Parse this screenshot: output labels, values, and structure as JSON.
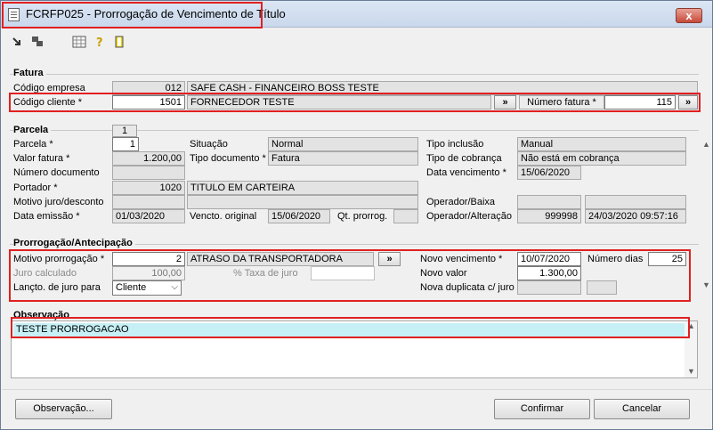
{
  "window": {
    "title": "FCRFP025 - Prorrogação de Vencimento de Título",
    "close": "x"
  },
  "toolbar": {
    "icons": [
      "arrow-icon",
      "copy-icon",
      "calculator-icon",
      "help-icon",
      "exit-door-icon"
    ]
  },
  "fatura": {
    "group_label": "Fatura",
    "empresa_label": "Código empresa",
    "empresa_code": "012",
    "empresa_name": "SAFE CASH - FINANCEIRO BOSS TESTE",
    "cliente_label": "Código cliente *",
    "cliente_code": "1501",
    "cliente_name": "FORNECEDOR TESTE",
    "lookup_btn": "»",
    "numero_label": "Número fatura *",
    "numero_value": "115",
    "numero_btn": "»"
  },
  "parcela": {
    "group_label": "Parcela",
    "tab_label": "1",
    "parcela_label": "Parcela *",
    "parcela_value": "1",
    "valor_label": "Valor fatura *",
    "valor_value": "1.200,00",
    "numero_doc_label": "Número documento",
    "numero_doc_value": "",
    "portador_label": "Portador *",
    "portador_code": "1020",
    "portador_name": "TITULO EM CARTEIRA",
    "motivo_label": "Motivo juro/desconto",
    "motivo_code": "",
    "motivo_name": "",
    "emissao_label": "Data emissão *",
    "emissao_value": "01/03/2020",
    "situacao_label": "Situação",
    "situacao_value": "Normal",
    "tipo_doc_label": "Tipo documento *",
    "tipo_doc_value": "Fatura",
    "vencto_label": "Vencto. original",
    "vencto_value": "15/06/2020",
    "qt_label": "Qt. prorrog.",
    "qt_value": "",
    "tipo_inclusao_label": "Tipo inclusão",
    "tipo_inclusao_value": "Manual",
    "tipo_cobranca_label": "Tipo de cobrança",
    "tipo_cobranca_value": "Não está em cobrança",
    "data_venc_label": "Data vencimento *",
    "data_venc_value": "15/06/2020",
    "op_baixa_label": "Operador/Baixa",
    "op_baixa_code": "",
    "op_baixa_date": "",
    "op_alt_label": "Operador/Alteração",
    "op_alt_code": "999998",
    "op_alt_date": "24/03/2020 09:57:16"
  },
  "prorrogacao": {
    "group_label": "Prorrogação/Antecipação",
    "motivo_label": "Motivo prorrogação *",
    "motivo_code": "2",
    "motivo_name": "ATRASO DA TRANSPORTADORA",
    "motivo_btn": "»",
    "juro_calc_label": "Juro calculado",
    "juro_calc_value": "100,00",
    "taxa_label": "% Taxa de juro",
    "taxa_value": "",
    "lancto_label": "Lançto. de juro para",
    "lancto_value": "Cliente",
    "novo_venc_label": "Novo vencimento *",
    "novo_venc_value": "10/07/2020",
    "numero_dias_label": "Número dias",
    "numero_dias_value": "25",
    "novo_valor_label": "Novo valor",
    "novo_valor_value": "1.300,00",
    "nova_dup_label": "Nova duplicata c/ juro",
    "nova_dup_value": "",
    "nova_dup_extra": ""
  },
  "observacao": {
    "group_label": "Observação",
    "text": "TESTE PRORROGACAO"
  },
  "buttons": {
    "observacao": "Observação...",
    "confirmar": "Confirmar",
    "cancelar": "Cancelar"
  }
}
